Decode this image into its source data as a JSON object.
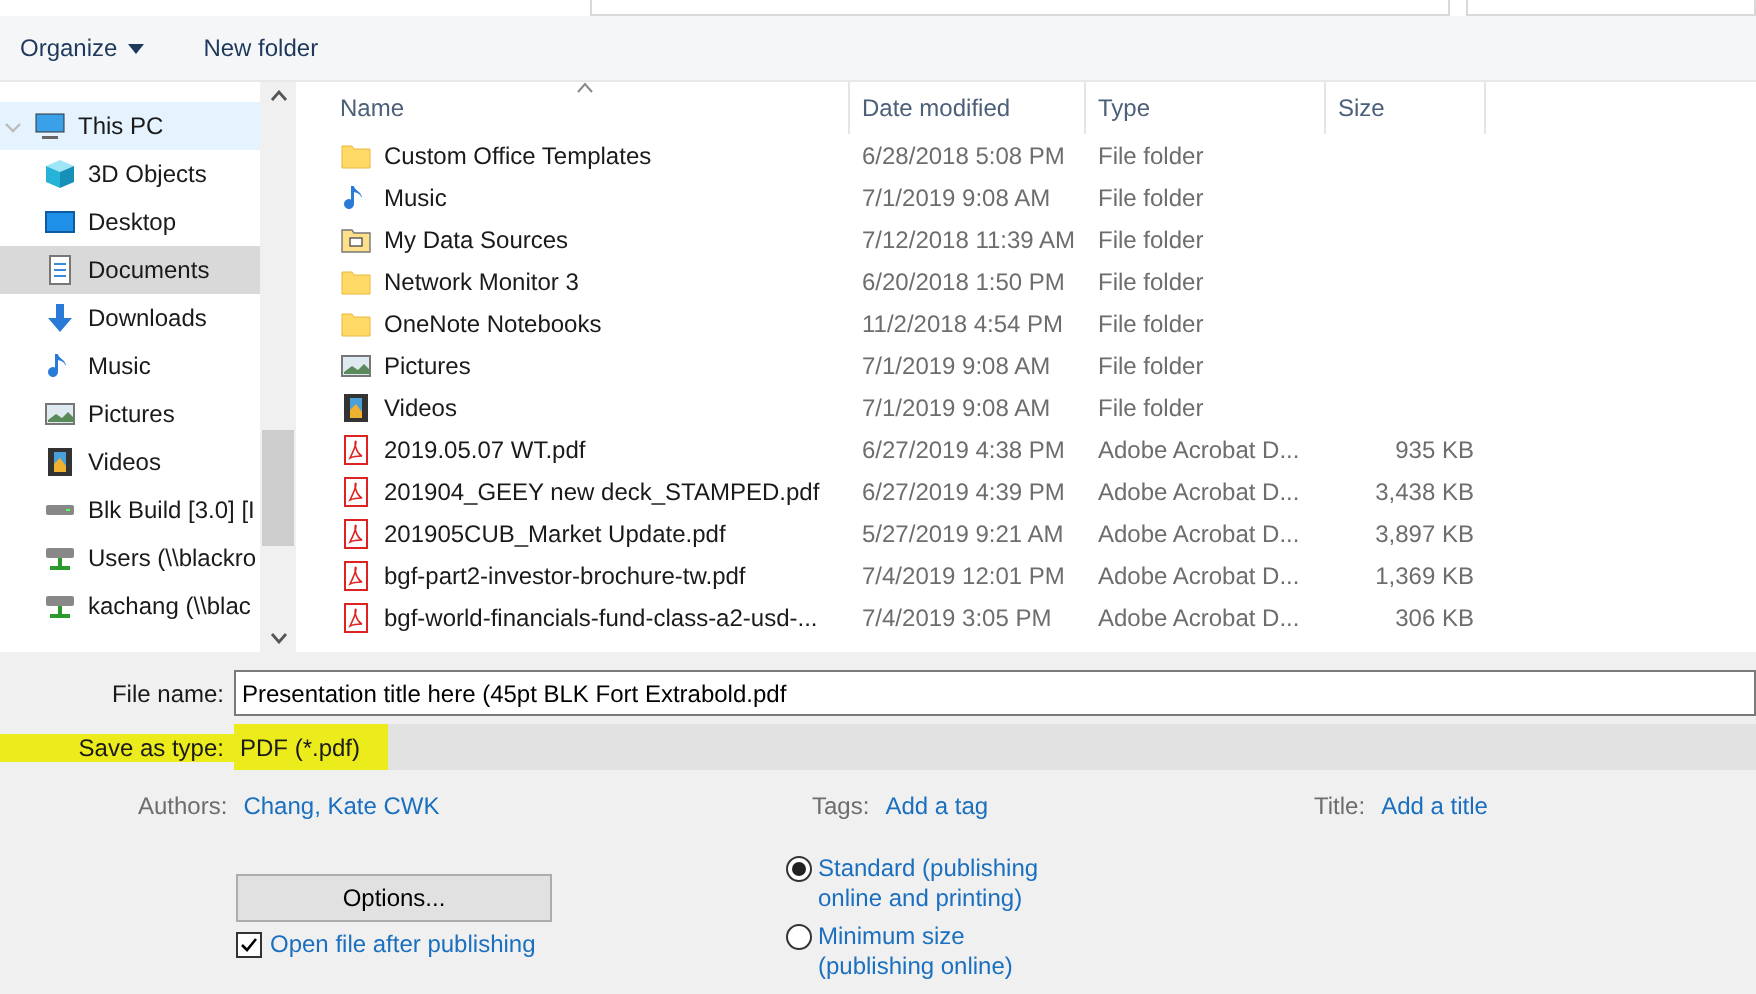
{
  "toolbar": {
    "organize": "Organize",
    "new_folder": "New folder"
  },
  "nav": {
    "items": [
      {
        "label": "This PC",
        "kind": "pc",
        "selected": false,
        "hovered": true,
        "expanded": true,
        "children": [
          {
            "label": "3D Objects",
            "kind": "cube",
            "selected": false,
            "hovered": false
          },
          {
            "label": "Desktop",
            "kind": "desktop",
            "selected": false,
            "hovered": false
          },
          {
            "label": "Documents",
            "kind": "documents",
            "selected": true,
            "hovered": false
          },
          {
            "label": "Downloads",
            "kind": "downloads",
            "selected": false,
            "hovered": false
          },
          {
            "label": "Music",
            "kind": "music",
            "selected": false,
            "hovered": false
          },
          {
            "label": "Pictures",
            "kind": "pictures",
            "selected": false,
            "hovered": false
          },
          {
            "label": "Videos",
            "kind": "videos",
            "selected": false,
            "hovered": false
          },
          {
            "label": "Blk Build [3.0] [I",
            "kind": "drive",
            "selected": false,
            "hovered": false
          },
          {
            "label": "Users (\\\\blackro",
            "kind": "netdrive",
            "selected": false,
            "hovered": false
          },
          {
            "label": "kachang (\\\\blac",
            "kind": "netdrive",
            "selected": false,
            "hovered": false
          }
        ]
      }
    ]
  },
  "table": {
    "columns": [
      "Name",
      "Date modified",
      "Type",
      "Size"
    ],
    "rows": [
      {
        "name": "Custom Office Templates",
        "kind": "folder",
        "date": "6/28/2018 5:08 PM",
        "type": "File folder"
      },
      {
        "name": "Music",
        "kind": "music",
        "date": "7/1/2019 9:08 AM",
        "type": "File folder"
      },
      {
        "name": "My Data Sources",
        "kind": "datafolder",
        "date": "7/12/2018 11:39 AM",
        "type": "File folder"
      },
      {
        "name": "Network Monitor 3",
        "kind": "folder",
        "date": "6/20/2018 1:50 PM",
        "type": "File folder"
      },
      {
        "name": "OneNote Notebooks",
        "kind": "folder",
        "date": "11/2/2018 4:54 PM",
        "type": "File folder"
      },
      {
        "name": "Pictures",
        "kind": "pictures",
        "date": "7/1/2019 9:08 AM",
        "type": "File folder"
      },
      {
        "name": "Videos",
        "kind": "videos",
        "date": "7/1/2019 9:08 AM",
        "type": "File folder"
      },
      {
        "name": "2019.05.07 WT.pdf",
        "kind": "pdf",
        "date": "6/27/2019 4:38 PM",
        "type": "Adobe Acrobat D...",
        "size": "935 KB"
      },
      {
        "name": "201904_GEEY new deck_STAMPED.pdf",
        "kind": "pdf",
        "date": "6/27/2019 4:39 PM",
        "type": "Adobe Acrobat D...",
        "size": "3,438 KB"
      },
      {
        "name": "201905CUB_Market Update.pdf",
        "kind": "pdf",
        "date": "5/27/2019 9:21 AM",
        "type": "Adobe Acrobat D...",
        "size": "3,897 KB"
      },
      {
        "name": "bgf-part2-investor-brochure-tw.pdf",
        "kind": "pdf",
        "date": "7/4/2019 12:01 PM",
        "type": "Adobe Acrobat D...",
        "size": "1,369 KB"
      },
      {
        "name": "bgf-world-financials-fund-class-a2-usd-...",
        "kind": "pdf",
        "date": "7/4/2019 3:05 PM",
        "type": "Adobe Acrobat D...",
        "size": "306 KB"
      }
    ]
  },
  "file_name": {
    "label": "File name:",
    "value": "Presentation title here (45pt BLK Fort Extrabold.pdf"
  },
  "save_as_type": {
    "label": "Save as type:",
    "value": "PDF (*.pdf)",
    "highlighted": true
  },
  "meta": [
    {
      "label": "Authors:",
      "value": "Chang, Kate CWK"
    },
    {
      "label": "Tags:",
      "value": "Add a tag"
    },
    {
      "label": "Title:",
      "value": "Add a title"
    }
  ],
  "options_button": "Options...",
  "open_after": {
    "label": "Open file after publishing",
    "checked": true
  },
  "optimize": [
    {
      "label": "Standard (publishing\nonline and printing)",
      "selected": true
    },
    {
      "label": "Minimum size\n(publishing online)",
      "selected": false
    }
  ]
}
